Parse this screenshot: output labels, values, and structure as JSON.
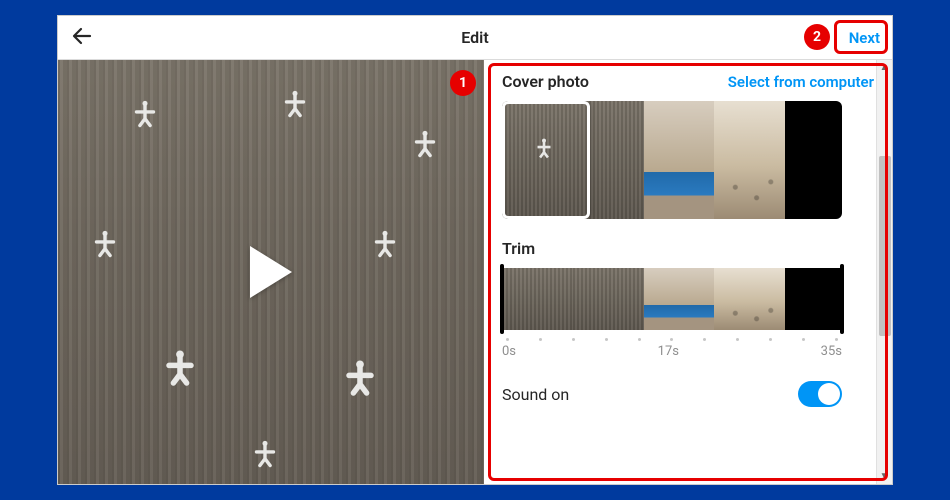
{
  "header": {
    "title": "Edit",
    "next_label": "Next"
  },
  "annotations": {
    "badge1": "1",
    "badge2": "2"
  },
  "cover": {
    "section_label": "Cover photo",
    "select_label": "Select from computer"
  },
  "trim": {
    "section_label": "Trim",
    "timeline": {
      "start": "0s",
      "mid": "17s",
      "end": "35s"
    }
  },
  "sound": {
    "label": "Sound on",
    "enabled": true
  },
  "colors": {
    "accent": "#0095f6",
    "annotation": "#e60000",
    "page_bg": "#003a9e"
  }
}
